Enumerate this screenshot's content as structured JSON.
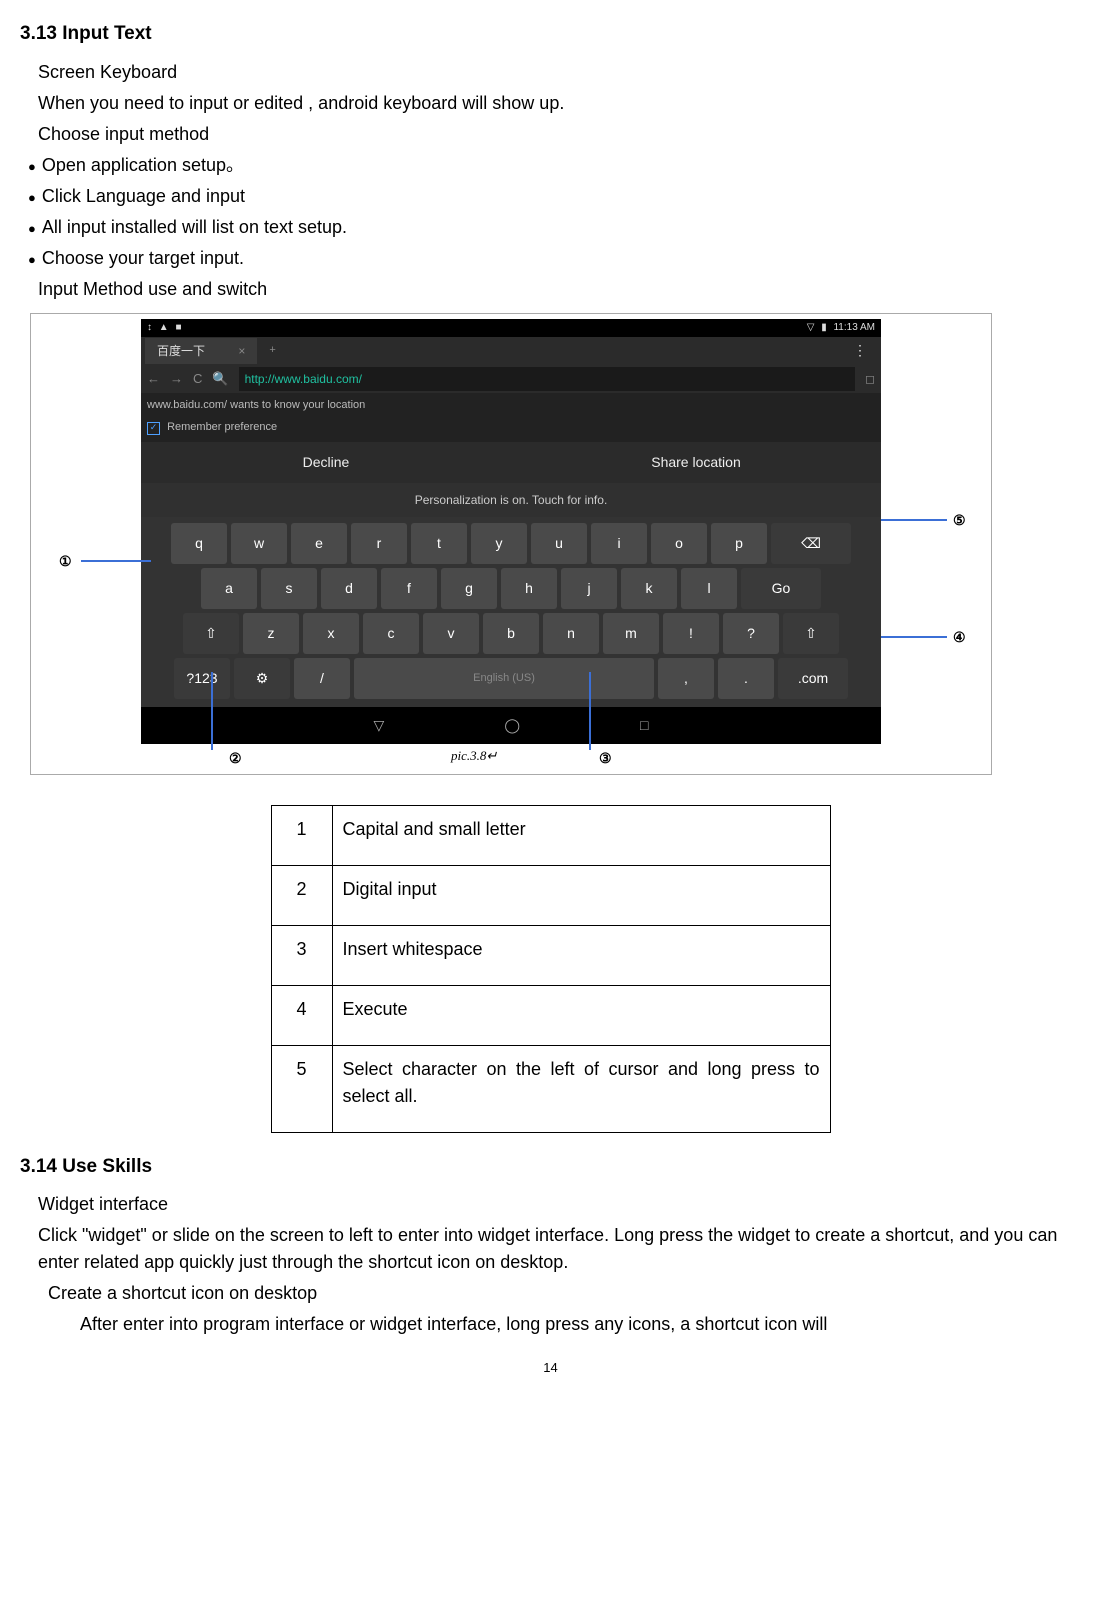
{
  "section313": {
    "heading": "3.13 Input Text",
    "p1": "Screen Keyboard",
    "p2": "When you need to input or edited , android keyboard will show up.",
    "p3": "Choose input method",
    "b1": "Open application setup。",
    "b2": "Click Language and input",
    "b3": "All input installed will list on text setup.",
    "b4": "Choose your target input.",
    "p4": "Input Method use and switch"
  },
  "screenshot": {
    "status_time": "11:13 AM",
    "tab_title": "百度一下",
    "url": "http://www.baidu.com/",
    "loc_msg": "www.baidu.com/ wants to know your location",
    "remember": "Remember preference",
    "decline": "Decline",
    "share": "Share location",
    "personalize": "Personalization is on. Touch for info.",
    "row1": [
      "q",
      "w",
      "e",
      "r",
      "t",
      "y",
      "u",
      "i",
      "o",
      "p"
    ],
    "row2": [
      "a",
      "s",
      "d",
      "f",
      "g",
      "h",
      "j",
      "k",
      "l"
    ],
    "go": "Go",
    "row3": [
      "z",
      "x",
      "c",
      "v",
      "b",
      "n",
      "m",
      "!",
      "?"
    ],
    "row4_num": "?123",
    "row4_slash": "/",
    "row4_space": "English (US)",
    "row4_comma": ",",
    "row4_dot": ".",
    "row4_com": ".com",
    "caption": "pic.3.8",
    "callouts": {
      "c1": "①",
      "c2": "②",
      "c3": "③",
      "c4": "④",
      "c5": "⑤"
    }
  },
  "table": {
    "r1": {
      "n": "1",
      "t": "Capital and small letter"
    },
    "r2": {
      "n": "2",
      "t": "Digital input"
    },
    "r3": {
      "n": "3",
      "t": "Insert whitespace"
    },
    "r4": {
      "n": "4",
      "t": "Execute"
    },
    "r5": {
      "n": "5",
      "t": "Select character on the left of cursor and long press to select all."
    }
  },
  "section314": {
    "heading": "3.14 Use Skills",
    "p1": "Widget interface",
    "p2": "Click \"widget\" or slide on the screen to left to enter into widget interface. Long press the widget to create a shortcut, and you can enter related app quickly just through the shortcut icon on desktop.",
    "p3": "Create a shortcut icon on desktop",
    "p4": "After enter into program interface or widget interface, long press any icons, a shortcut icon will"
  },
  "pagenum": "14"
}
